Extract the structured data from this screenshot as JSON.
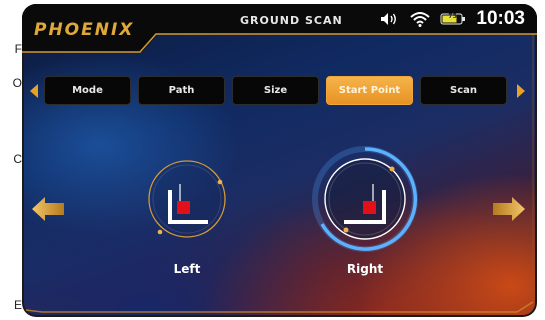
{
  "page_edge_fragments": [
    "F",
    "O",
    "C",
    "E"
  ],
  "header": {
    "logo": "PHOENIX",
    "title": "GROUND SCAN",
    "status": {
      "sound_icon": "speaker-icon",
      "wifi_icon": "wifi-icon",
      "battery_icon": "battery-icon",
      "battery_label": "75",
      "time": "10:03"
    }
  },
  "tabs": [
    {
      "label": "Mode",
      "active": false
    },
    {
      "label": "Path",
      "active": false
    },
    {
      "label": "Size",
      "active": false
    },
    {
      "label": "Start Point",
      "active": true
    },
    {
      "label": "Scan",
      "active": false
    }
  ],
  "options": {
    "left": {
      "label": "Left",
      "selected": false
    },
    "right": {
      "label": "Right",
      "selected": true
    }
  },
  "colors": {
    "accent": "#e6a323",
    "active_tab": "#f0a63a",
    "marker": "#e3101a",
    "selection_ring": "#4fa8ff"
  }
}
